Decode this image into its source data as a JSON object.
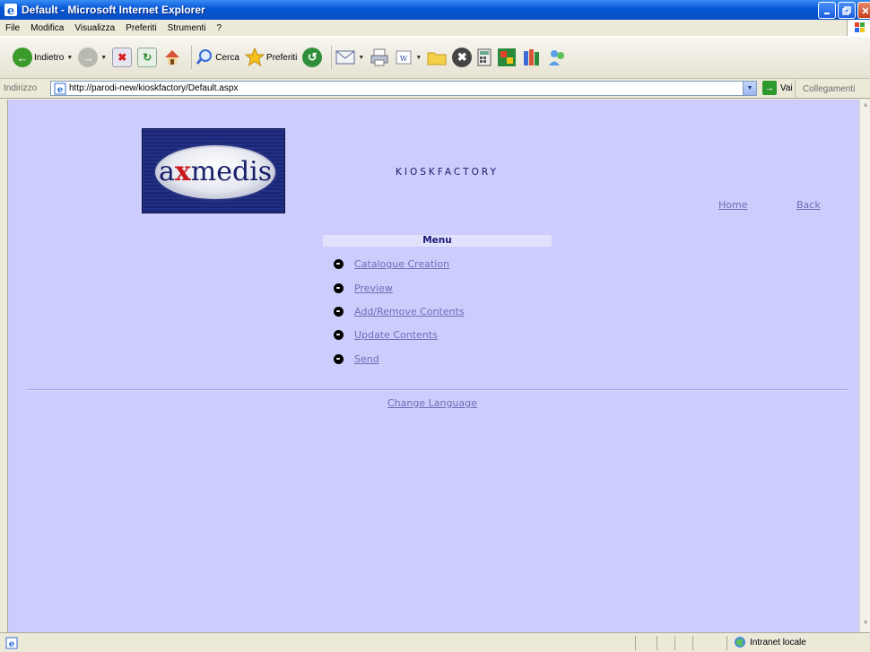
{
  "window": {
    "title": "Default - Microsoft Internet Explorer"
  },
  "menubar": {
    "items": [
      "File",
      "Modifica",
      "Visualizza",
      "Preferiti",
      "Strumenti",
      "?"
    ]
  },
  "toolbar": {
    "back_label": "Indietro",
    "search_label": "Cerca",
    "favorites_label": "Preferiti"
  },
  "addressbar": {
    "label": "Indirizzo",
    "url": "http://parodi-new/kioskfactory/Default.aspx",
    "go_label": "Vai",
    "links_label": "Collegamenti"
  },
  "page": {
    "brand": "KIOSKFACTORY",
    "logo_text_a": "a",
    "logo_text_x": "x",
    "logo_text_rest": "medis",
    "home_link": "Home",
    "back_link": "Back",
    "menu_title": "Menu",
    "menu_items": [
      "Catalogue Creation",
      "Preview",
      "Add/Remove Contents",
      "Update Contents",
      "Send"
    ],
    "change_language": "Change Language"
  },
  "statusbar": {
    "zone": "Intranet locale"
  },
  "colors": {
    "page_background": "#ccccfd",
    "link": "#6c71b5",
    "menu_header_bg": "#e1e1fb",
    "title_bar": "#0653d0"
  }
}
